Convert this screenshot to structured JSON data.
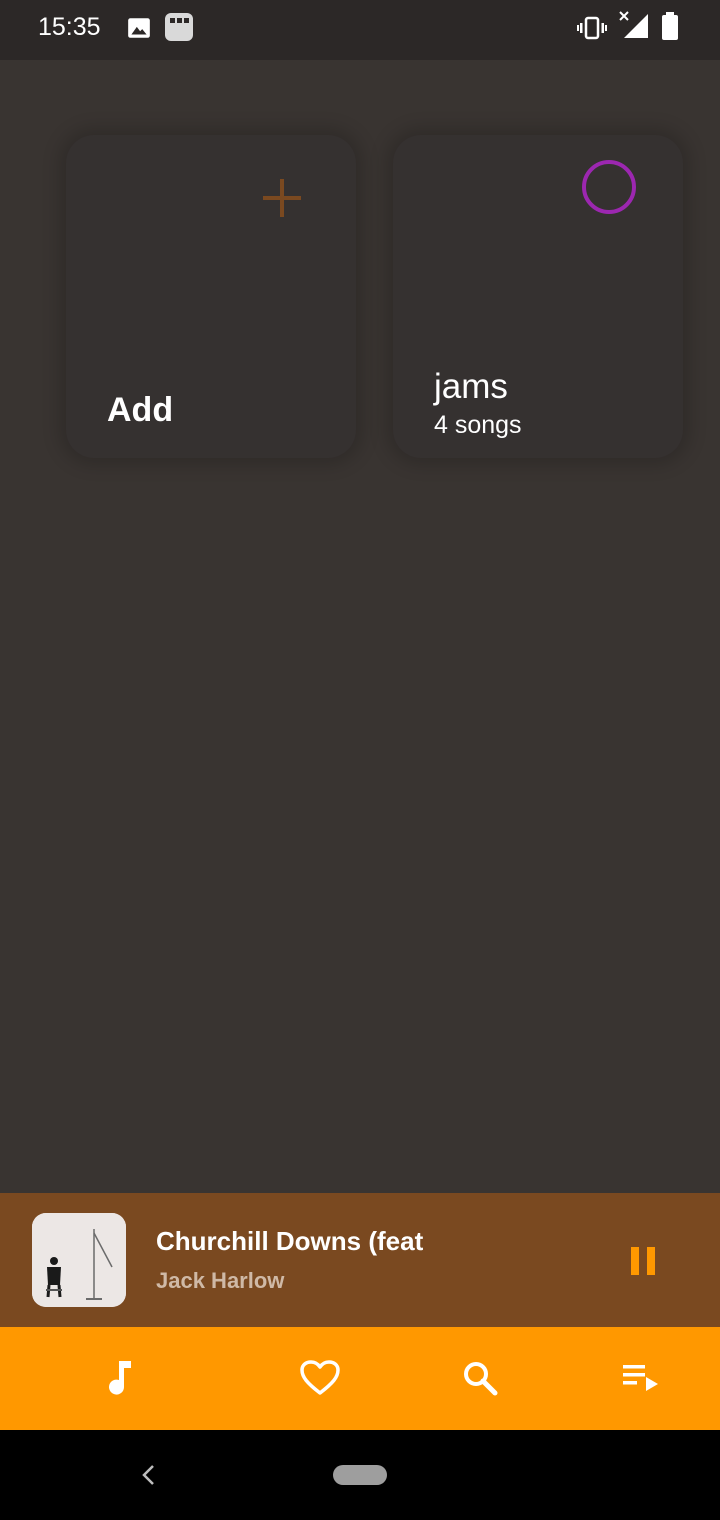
{
  "status_bar": {
    "time": "15:35",
    "icons": [
      "image-icon",
      "app-notification-icon",
      "vibrate-icon",
      "signal-no-data-icon",
      "battery-icon"
    ]
  },
  "cards": {
    "add": {
      "label": "Add",
      "icon": "plus-icon",
      "icon_color": "#7a4920"
    },
    "playlist": {
      "title": "jams",
      "subtitle": "4 songs",
      "icon": "circle-icon",
      "icon_color": "#9c27b0"
    }
  },
  "now_playing": {
    "title": "Churchill Downs (feat",
    "artist": "Jack Harlow",
    "control": "pause-icon"
  },
  "bottom_nav": {
    "items": [
      "music-note-icon",
      "heart-icon",
      "search-icon",
      "queue-play-icon"
    ]
  },
  "colors": {
    "accent": "#ff9800",
    "now_playing_bg": "#7a4920",
    "background": "#393431"
  }
}
